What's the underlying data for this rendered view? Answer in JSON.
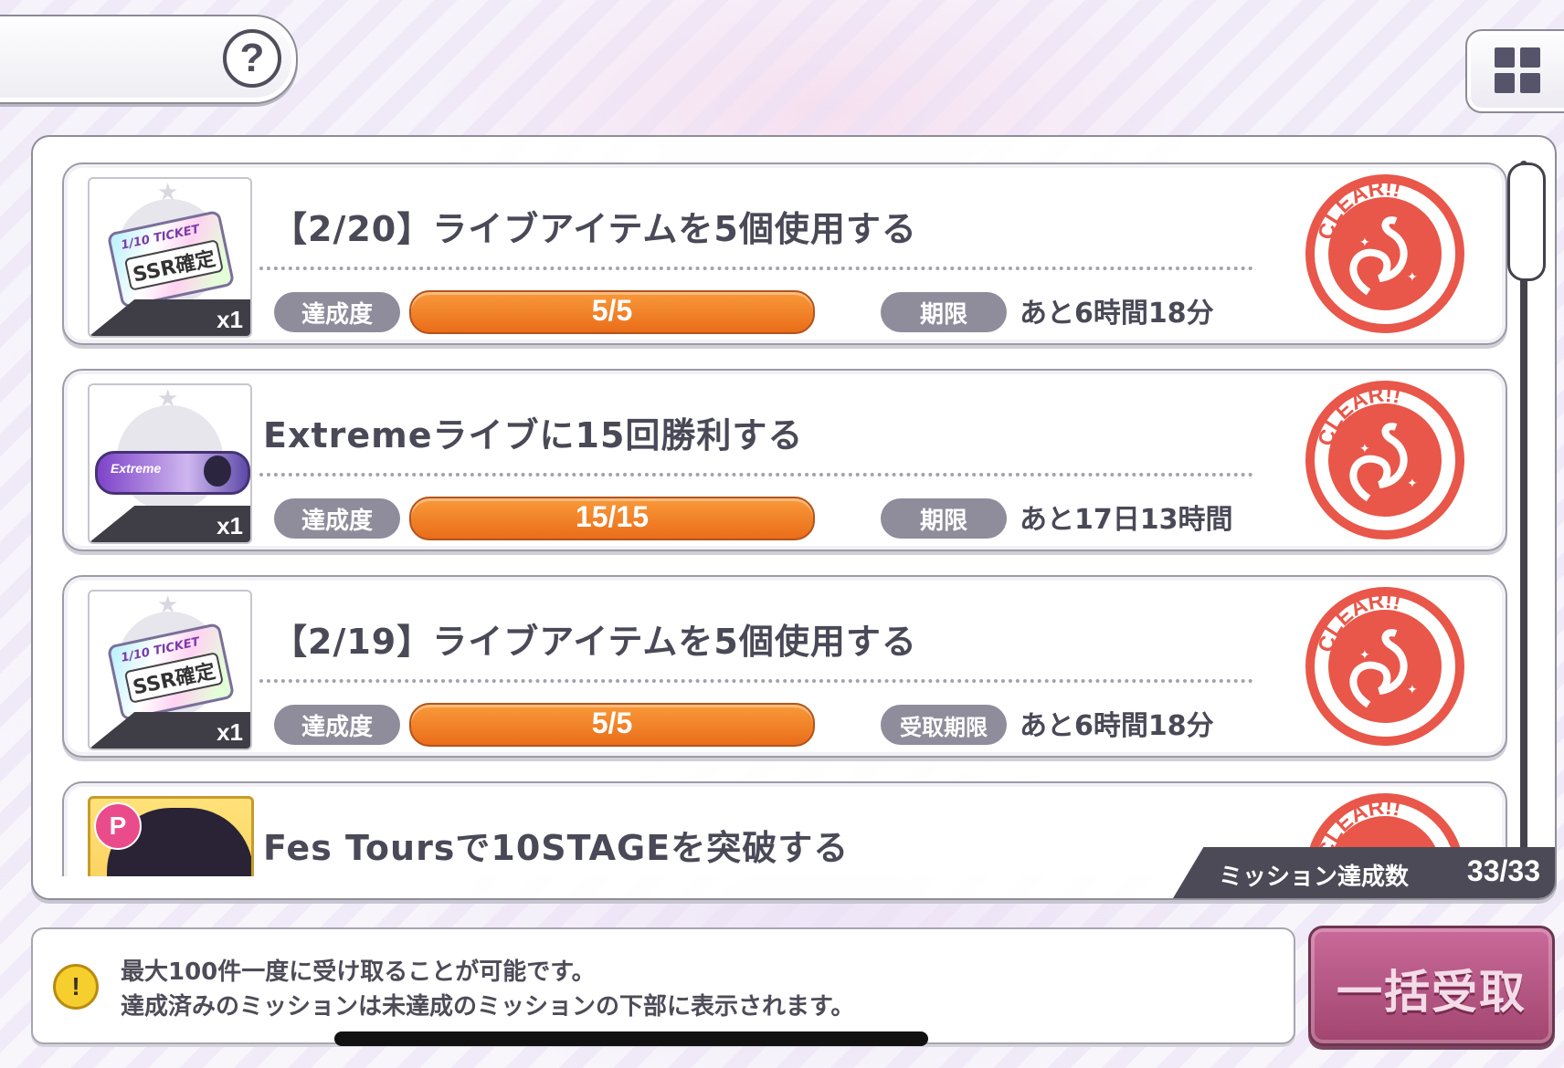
{
  "header": {
    "help_label": "?"
  },
  "missions": [
    {
      "title": "【2/20】ライブアイテムを5個使用する",
      "reward_type": "ticket",
      "reward_lines": [
        "1/10 TICKET",
        "SSR確定"
      ],
      "quantity": "x1",
      "progress_label": "達成度",
      "progress_text": "5/5",
      "progress_fraction": 1.0,
      "deadline_label": "期限",
      "deadline_text": "あと6時間18分",
      "status_stamp": "CLEAR!!"
    },
    {
      "title": "Extremeライブに15回勝利する",
      "reward_type": "extreme",
      "reward_lines": [
        "Extreme"
      ],
      "quantity": "x1",
      "progress_label": "達成度",
      "progress_text": "15/15",
      "progress_fraction": 1.0,
      "deadline_label": "期限",
      "deadline_text": "あと17日13時間",
      "status_stamp": "CLEAR!!"
    },
    {
      "title": "【2/19】ライブアイテムを5個使用する",
      "reward_type": "ticket",
      "reward_lines": [
        "1/10 TICKET",
        "SSR確定"
      ],
      "quantity": "x1",
      "progress_label": "達成度",
      "progress_text": "5/5",
      "progress_fraction": 1.0,
      "deadline_label": "受取期限",
      "deadline_text": "あと6時間18分",
      "status_stamp": "CLEAR!!"
    },
    {
      "title": "Fes Toursで10STAGEを突破する",
      "reward_type": "character",
      "reward_lines": [
        "P"
      ],
      "status_stamp": "CLEAR!!"
    }
  ],
  "mission_count": {
    "label": "ミッション達成数",
    "value": "33/33"
  },
  "info": {
    "icon": "warning-icon",
    "line1": "最大100件一度に受け取ることが可能です。",
    "line2": "達成済みのミッションは未達成のミッションの下部に表示されます。"
  },
  "bulk_receive_label": "一括受取",
  "colors": {
    "progress": "#ee7a22",
    "stamp": "#e8574a",
    "label_pill": "#8f8c9b",
    "bulk_button": "#b4557f"
  }
}
